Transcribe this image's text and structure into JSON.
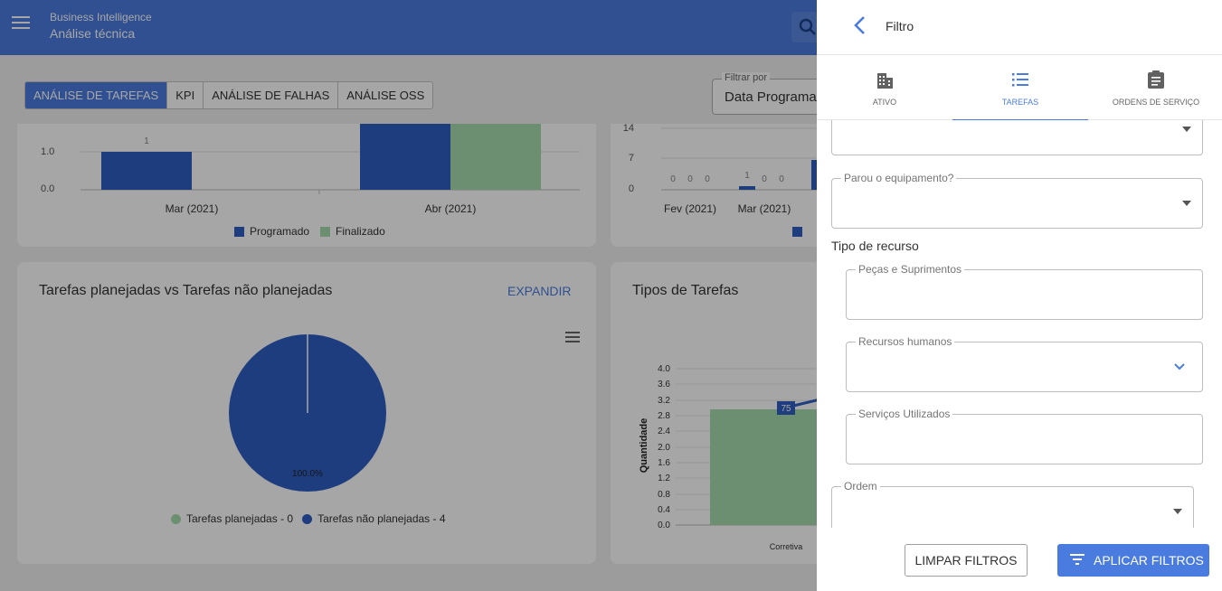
{
  "appbar": {
    "subtitle": "Business Intelligence",
    "title": "Análise técnica"
  },
  "tabs": [
    "ANÁLISE DE TAREFAS",
    "KPI",
    "ANÁLISE DE FALHAS",
    "ANÁLISE OSS"
  ],
  "filter_by": {
    "label": "Filtrar por",
    "value": "Data Programada"
  },
  "card1": {
    "legend": [
      "Programado",
      "Finalizado"
    ],
    "colors": {
      "programado": "#2f5fc4",
      "finalizado": "#a6dcb0"
    }
  },
  "card3": {
    "title": "Tarefas planejadas vs Tarefas não planejadas",
    "expand": "EXPANDIR",
    "legend": [
      "Tarefas planejadas - 0",
      "Tarefas não planejadas - 4"
    ]
  },
  "card4": {
    "title": "Tipos de Tarefas"
  },
  "chart_data": [
    {
      "type": "bar",
      "categories": [
        "Mar (2021)",
        "Abr (2021)"
      ],
      "series": [
        {
          "name": "Programado",
          "values": [
            1,
            null
          ]
        },
        {
          "name": "Finalizado",
          "values": [
            null,
            null
          ]
        }
      ],
      "yticks": [
        "0.0",
        "1.0"
      ],
      "data_labels": [
        "1"
      ]
    },
    {
      "type": "bar",
      "categories": [
        "Fev (2021)",
        "Mar (2021)"
      ],
      "yticks": [
        "0",
        "7",
        "14"
      ],
      "data_labels": [
        [
          "0",
          "0",
          "0"
        ],
        [
          "1",
          "0",
          "0"
        ]
      ]
    },
    {
      "type": "pie",
      "slices": [
        {
          "name": "Tarefas planejadas",
          "value": 0
        },
        {
          "name": "Tarefas não planejadas",
          "value": 4
        }
      ],
      "slice_label": "100.0%"
    },
    {
      "type": "bar",
      "categories": [
        "Corretiva"
      ],
      "ylabel": "Quantidade",
      "yticks": [
        "0.0",
        "0.4",
        "0.8",
        "1.2",
        "1.6",
        "2.0",
        "2.4",
        "2.8",
        "3.2",
        "3.6",
        "4.0"
      ],
      "values": [
        3
      ],
      "line_label": "75"
    }
  ],
  "drawer": {
    "title": "Filtro",
    "tabs": [
      {
        "label": "ATIVO",
        "icon": "building-icon"
      },
      {
        "label": "TAREFAS",
        "icon": "list-icon"
      },
      {
        "label": "ORDENS DE SERVIÇO",
        "icon": "clipboard-icon"
      }
    ],
    "fields": {
      "stopped": "Parou o equipamento?",
      "section": "Tipo de recurso",
      "parts": "Peças e Suprimentos",
      "human": "Recursos humanos",
      "services": "Serviços Utilizados",
      "order": "Ordem"
    },
    "buttons": {
      "clear": "LIMPAR FILTROS",
      "apply": "APLICAR FILTROS"
    }
  }
}
